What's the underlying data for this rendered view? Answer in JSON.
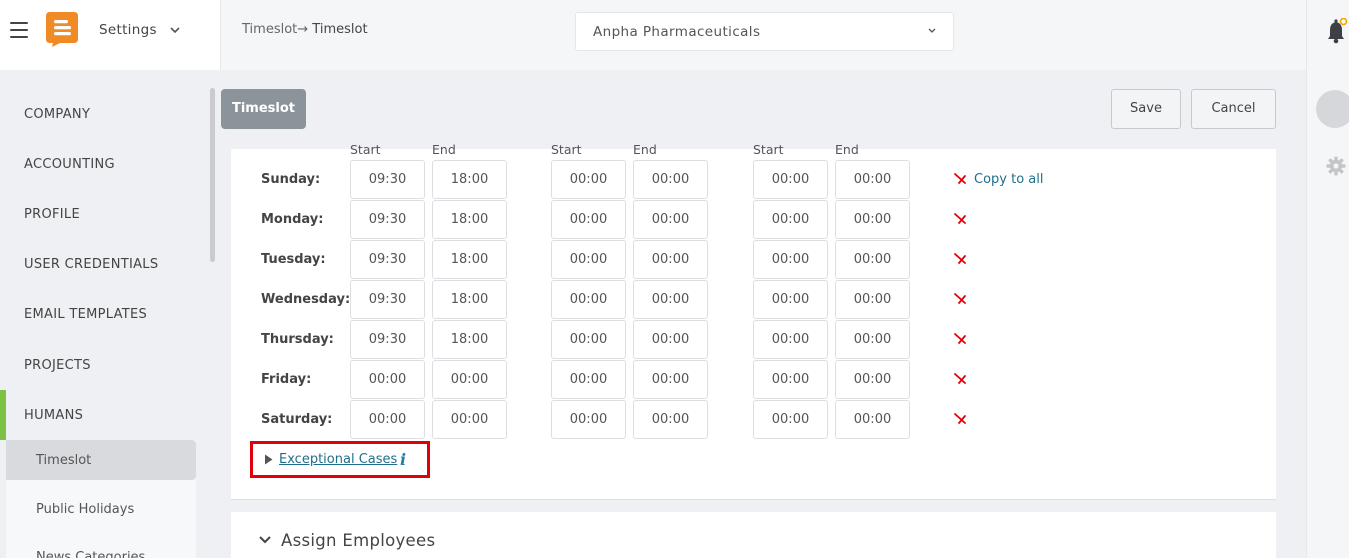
{
  "header": {
    "settings_label": "Settings",
    "breadcrumb_parent": "Timeslot",
    "breadcrumb_arrow": "→",
    "breadcrumb_current": "Timeslot",
    "company": "Anpha Pharmaceuticals"
  },
  "sidebar": {
    "items": [
      {
        "label": "COMPANY"
      },
      {
        "label": "ACCOUNTING"
      },
      {
        "label": "PROFILE"
      },
      {
        "label": "USER CREDENTIALS"
      },
      {
        "label": "EMAIL TEMPLATES"
      },
      {
        "label": "PROJECTS"
      },
      {
        "label": "HUMANS"
      }
    ],
    "subitems": [
      {
        "label": "Timeslot"
      },
      {
        "label": "Public Holidays"
      },
      {
        "label": "News Categories"
      }
    ]
  },
  "toolbar": {
    "tab_label": "Timeslot",
    "save_label": "Save",
    "cancel_label": "Cancel"
  },
  "schedule": {
    "start_label": "Start",
    "end_label": "End",
    "copy_all_label": "Copy to all",
    "days": [
      {
        "name": "Sunday:",
        "times": [
          "09:30",
          "18:00",
          "00:00",
          "00:00",
          "00:00",
          "00:00"
        ]
      },
      {
        "name": "Monday:",
        "times": [
          "09:30",
          "18:00",
          "00:00",
          "00:00",
          "00:00",
          "00:00"
        ]
      },
      {
        "name": "Tuesday:",
        "times": [
          "09:30",
          "18:00",
          "00:00",
          "00:00",
          "00:00",
          "00:00"
        ]
      },
      {
        "name": "Wednesday:",
        "times": [
          "09:30",
          "18:00",
          "00:00",
          "00:00",
          "00:00",
          "00:00"
        ]
      },
      {
        "name": "Thursday:",
        "times": [
          "09:30",
          "18:00",
          "00:00",
          "00:00",
          "00:00",
          "00:00"
        ]
      },
      {
        "name": "Friday:",
        "times": [
          "00:00",
          "00:00",
          "00:00",
          "00:00",
          "00:00",
          "00:00"
        ]
      },
      {
        "name": "Saturday:",
        "times": [
          "00:00",
          "00:00",
          "00:00",
          "00:00",
          "00:00",
          "00:00"
        ]
      }
    ],
    "exceptional_label": "Exceptional Cases",
    "info_glyph": "i"
  },
  "assign": {
    "title": "Assign Employees"
  },
  "colors": {
    "accent_green": "#7dc243",
    "logo_orange": "#f08a24",
    "link_blue": "#1f6f8b",
    "highlight_red": "#e0000b",
    "x_red": "#e0000b"
  },
  "icons": [
    "menu-icon",
    "logo-icon",
    "chevron-down-icon",
    "bell-icon",
    "gear-icon",
    "close-x-icon",
    "caret-right-icon",
    "info-icon"
  ]
}
